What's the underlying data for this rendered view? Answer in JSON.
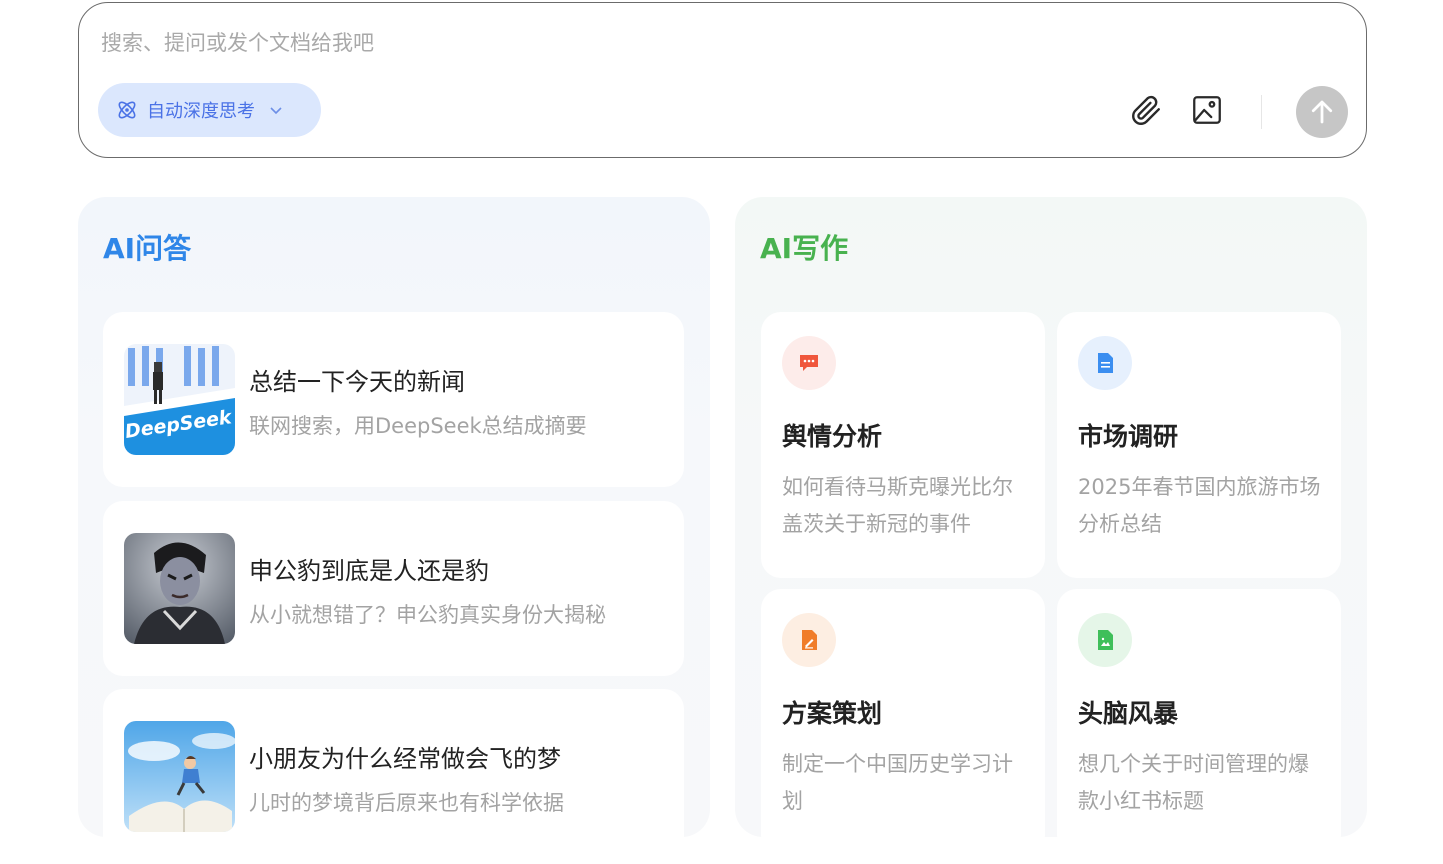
{
  "search": {
    "placeholder": "搜索、提问或发个文档给我吧",
    "value": "",
    "mode_label": "自动深度思考",
    "icons": [
      "atom-icon",
      "chevron-down-icon",
      "paperclip-icon",
      "image-icon",
      "arrow-up-icon"
    ]
  },
  "qa": {
    "title": "AI问答",
    "items": [
      {
        "title": "总结一下今天的新闻",
        "subtitle": "联网搜索，用DeepSeek总结成摘要",
        "thumb_text": "DeepSeek"
      },
      {
        "title": "申公豹到底是人还是豹",
        "subtitle": "从小就想错了？申公豹真实身份大揭秘"
      },
      {
        "title": "小朋友为什么经常做会飞的梦",
        "subtitle": "儿时的梦境背后原来也有科学依据"
      }
    ]
  },
  "writing": {
    "title": "AI写作",
    "items": [
      {
        "title": "舆情分析",
        "desc": "如何看待马斯克曝光比尔盖茨关于新冠的事件",
        "icon": "chat-bubble-icon",
        "color": "#f0563c"
      },
      {
        "title": "市场调研",
        "desc": "2025年春节国内旅游市场分析总结",
        "icon": "document-icon",
        "color": "#3b8ef0"
      },
      {
        "title": "方案策划",
        "desc": "制定一个中国历史学习计划",
        "icon": "pen-doc-icon",
        "color": "#f07d2a"
      },
      {
        "title": "头脑风暴",
        "desc": "想几个关于时间管理的爆款小红书标题",
        "icon": "image-doc-icon",
        "color": "#3fbf5a"
      }
    ]
  },
  "colors": {
    "qa_title": "#2f86e8",
    "writing_title": "#48b24f",
    "deep_think_bg": "#dbe7fd",
    "deep_think_text": "#4a72e6",
    "send_button": "#c6c6c6"
  }
}
